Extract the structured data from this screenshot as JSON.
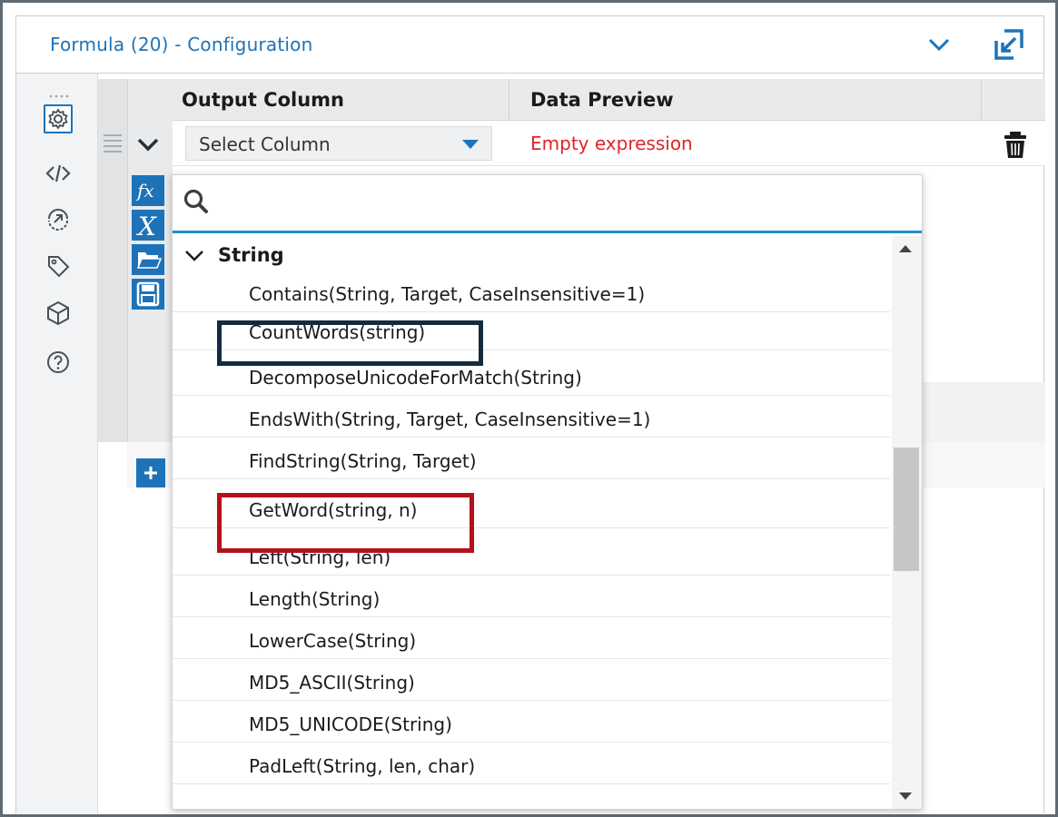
{
  "window": {
    "title": "Formula (20) - Configuration",
    "icons": {
      "collapse": "chevron-down-icon",
      "popout": "popout-icon"
    }
  },
  "rail": {
    "icons": [
      "settings-icon",
      "code-icon",
      "navigate-icon",
      "tag-icon",
      "cube-icon",
      "help-icon"
    ],
    "active": "settings-icon"
  },
  "grid": {
    "header": {
      "output_column": "Output Column",
      "data_preview": "Data Preview"
    },
    "row": {
      "select_placeholder": "Select Column",
      "preview": "Empty expression"
    },
    "tools": [
      "function-icon",
      "variable-icon",
      "open-folder-icon",
      "save-icon"
    ],
    "add_icon": "plus-icon"
  },
  "dropdown": {
    "search": {
      "placeholder": "",
      "value": ""
    },
    "category": "String",
    "items": [
      "Contains(String, Target, CaseInsensitive=1)",
      "CountWords(string)",
      "DecomposeUnicodeForMatch(String)",
      "EndsWith(String, Target, CaseInsensitive=1)",
      "FindString(String, Target)",
      "GetWord(string, n)",
      "Left(String, len)",
      "Length(String)",
      "LowerCase(String)",
      "MD5_ASCII(String)",
      "MD5_UNICODE(String)",
      "PadLeft(String, len, char)"
    ],
    "highlighted": [
      "CountWords(string)",
      "GetWord(string, n)"
    ]
  },
  "colors": {
    "accent": "#1e73b8",
    "error": "#e0232b",
    "highlight_dark": "#142b3f",
    "highlight_red": "#b3121b"
  }
}
